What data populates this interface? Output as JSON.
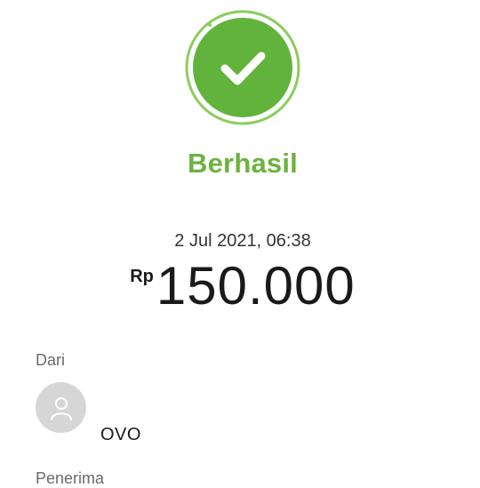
{
  "status": {
    "icon": "check-circle-icon",
    "title": "Berhasil",
    "color": "#6cb33f"
  },
  "transaction": {
    "datetime": "2 Jul 2021, 06:38",
    "currency": "Rp",
    "amount": "150.000"
  },
  "from": {
    "label": "Dari",
    "avatar_icon": "person-icon",
    "name": "OVO"
  },
  "to": {
    "label": "Penerima"
  }
}
